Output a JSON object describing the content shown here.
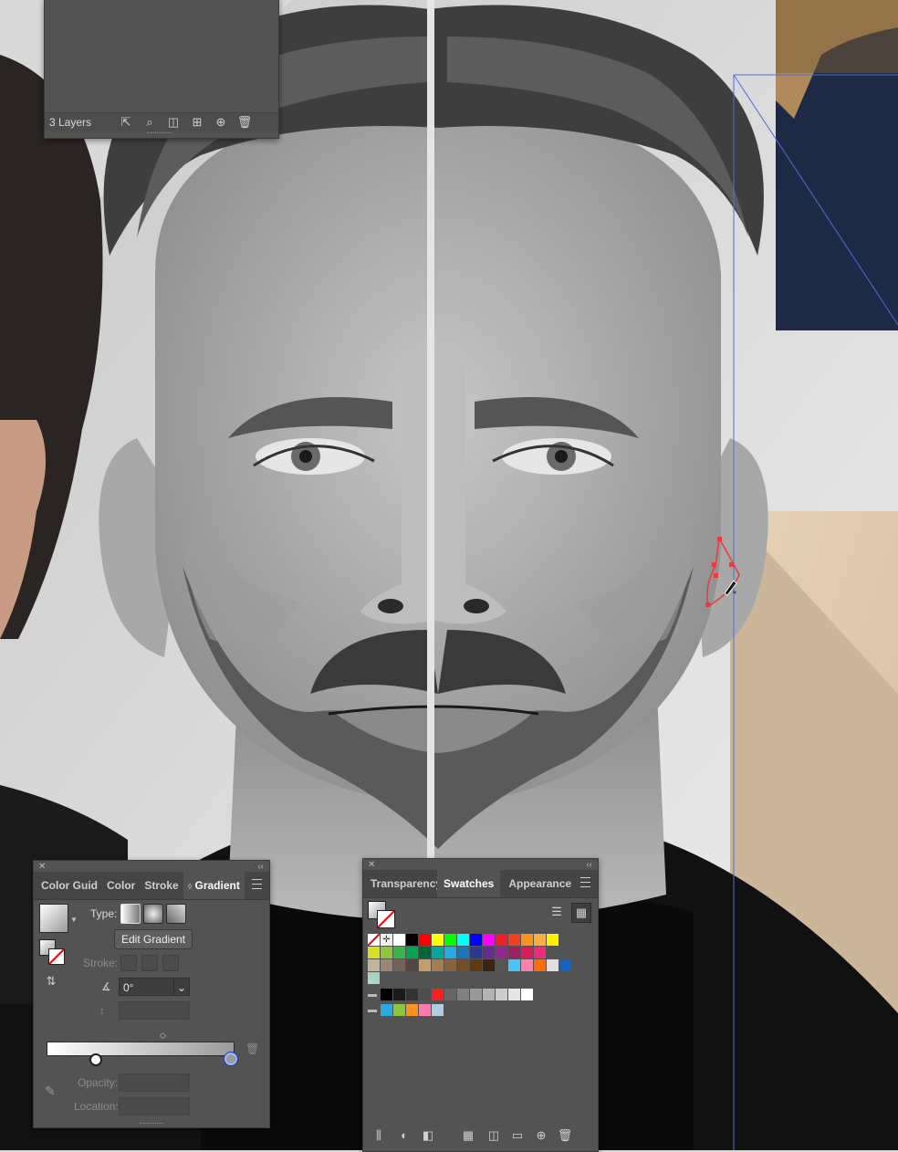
{
  "layers_panel": {
    "count_label": "3 Layers",
    "icons": [
      "export-icon",
      "search-icon",
      "clipping-mask-icon",
      "sublayer-icon",
      "new-layer-icon",
      "trash-icon"
    ]
  },
  "gradient_panel": {
    "tabs": [
      "Color Guid",
      "Color",
      "Stroke",
      "Gradient"
    ],
    "active_tab": "Gradient",
    "type_label": "Type:",
    "edit_button": "Edit Gradient",
    "stroke_label": "Stroke:",
    "angle_value": "0°",
    "opacity_label": "Opacity:",
    "location_label": "Location:"
  },
  "swatches_panel": {
    "tabs": [
      "Transparency",
      "Swatches",
      "Appearance"
    ],
    "active_tab": "Swatches",
    "row1": [
      "#ffffff",
      "#000000",
      "#ff0000",
      "#ffff00",
      "#00ff00",
      "#00ffff",
      "#0000ff",
      "#ff00ff",
      "#e8212c",
      "#ee4023",
      "#f7941d",
      "#fbb040",
      "#fff200"
    ],
    "row2": [
      "#d7df23",
      "#8dc63f",
      "#39b54a",
      "#00a651",
      "#006838",
      "#00a99d",
      "#27aae1",
      "#1c75bc",
      "#2b3990",
      "#662d91",
      "#92278f",
      "#9e1f63",
      "#da1c5c",
      "#ee2a7b"
    ],
    "row3": [
      "#c2b59b",
      "#998675",
      "#736357",
      "#534741",
      "#c69c6d",
      "#a67c52",
      "#8c6239",
      "#754c24",
      "#603913",
      "#3c2415",
      "#555555",
      "#4fc3f7",
      "#ff80ab",
      "#ff6d00",
      "#e0e0e0",
      "#1565c0"
    ],
    "group1": [
      "#000000",
      "#1a1a1a",
      "#333333",
      "#4d4d4d",
      "#ff1d25",
      "#666666",
      "#808080",
      "#999999",
      "#b3b3b3",
      "#cccccc",
      "#e6e6e6",
      "#ffffff"
    ],
    "group2": [
      "#29abe2",
      "#8cc63f",
      "#f7931e",
      "#ff7bac",
      "#b3cde0"
    ]
  },
  "colors": {
    "panel_bg": "#535353",
    "tab_bar": "#454545",
    "guide_blue": "#4a6fd6",
    "selection_red": "#e63c3c"
  }
}
